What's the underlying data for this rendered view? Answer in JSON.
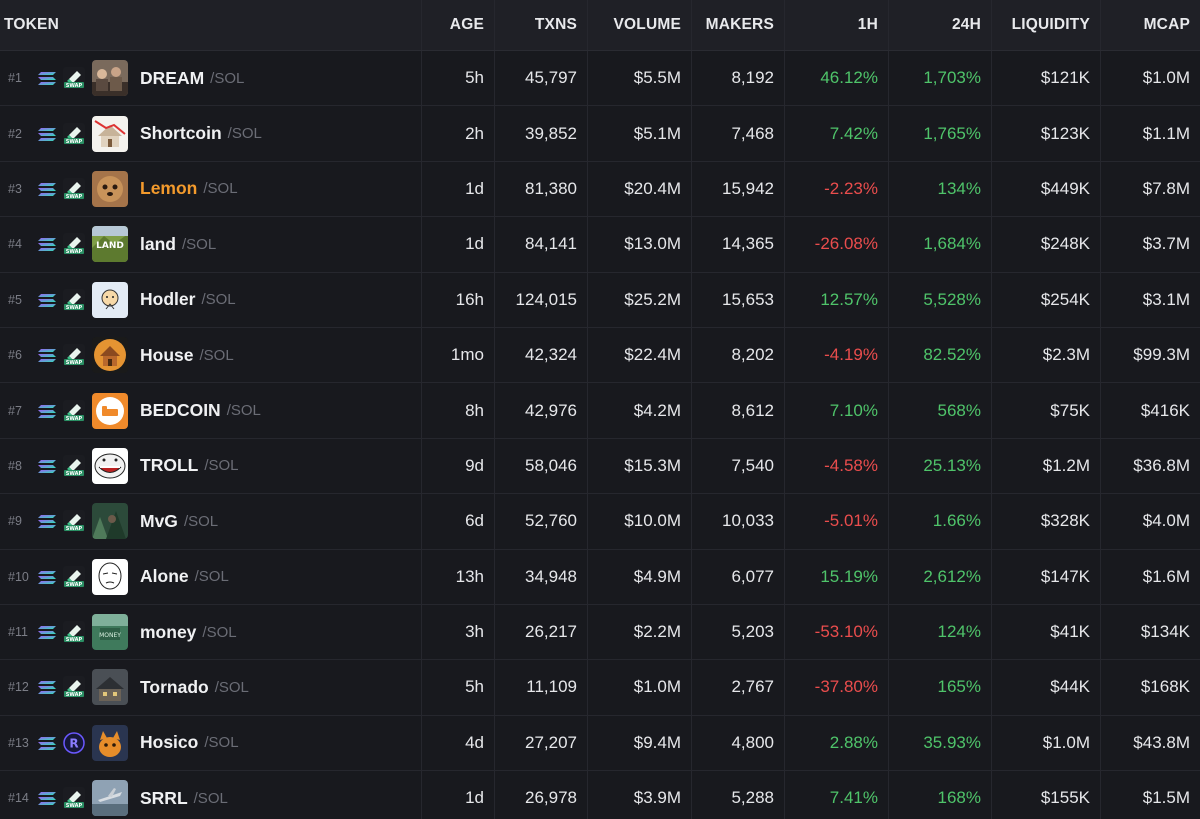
{
  "header": {
    "token": "TOKEN",
    "age": "AGE",
    "txns": "TXNS",
    "volume": "VOLUME",
    "makers": "MAKERS",
    "h1": "1H",
    "h24": "24H",
    "liquidity": "LIQUIDITY",
    "mcap": "MCAP"
  },
  "colors": {
    "positive": "#4fc46a",
    "negative": "#ea4d4d",
    "highlight": "#f39a2c"
  },
  "rows": [
    {
      "rank": "#1",
      "symbol": "DREAM",
      "quote": "/SOL",
      "dex": "swap-icon",
      "avatar": "dream-avatar",
      "age": "5h",
      "txns": "45,797",
      "volume": "$5.5M",
      "makers": "8,192",
      "h1": "46.12%",
      "h1_dir": "pos",
      "h24": "1,703%",
      "h24_dir": "pos",
      "liquidity": "$121K",
      "mcap": "$1.0M"
    },
    {
      "rank": "#2",
      "symbol": "Shortcoin",
      "quote": "/SOL",
      "dex": "swap-icon",
      "avatar": "shortcoin-avatar",
      "age": "2h",
      "txns": "39,852",
      "volume": "$5.1M",
      "makers": "7,468",
      "h1": "7.42%",
      "h1_dir": "pos",
      "h24": "1,765%",
      "h24_dir": "pos",
      "liquidity": "$123K",
      "mcap": "$1.1M"
    },
    {
      "rank": "#3",
      "symbol": "Lemon",
      "quote": "/SOL",
      "dex": "swap-icon",
      "avatar": "lemon-avatar",
      "age": "1d",
      "txns": "81,380",
      "volume": "$20.4M",
      "makers": "15,942",
      "h1": "-2.23%",
      "h1_dir": "neg",
      "h24": "134%",
      "h24_dir": "pos",
      "liquidity": "$449K",
      "mcap": "$7.8M",
      "highlight": true
    },
    {
      "rank": "#4",
      "symbol": "land",
      "quote": "/SOL",
      "dex": "swap-icon",
      "avatar": "land-avatar",
      "age": "1d",
      "txns": "84,141",
      "volume": "$13.0M",
      "makers": "14,365",
      "h1": "-26.08%",
      "h1_dir": "neg",
      "h24": "1,684%",
      "h24_dir": "pos",
      "liquidity": "$248K",
      "mcap": "$3.7M"
    },
    {
      "rank": "#5",
      "symbol": "Hodler",
      "quote": "/SOL",
      "dex": "swap-icon",
      "avatar": "hodler-avatar",
      "age": "16h",
      "txns": "124,015",
      "volume": "$25.2M",
      "makers": "15,653",
      "h1": "12.57%",
      "h1_dir": "pos",
      "h24": "5,528%",
      "h24_dir": "pos",
      "liquidity": "$254K",
      "mcap": "$3.1M"
    },
    {
      "rank": "#6",
      "symbol": "House",
      "quote": "/SOL",
      "dex": "swap-icon",
      "avatar": "house-avatar",
      "age": "1mo",
      "txns": "42,324",
      "volume": "$22.4M",
      "makers": "8,202",
      "h1": "-4.19%",
      "h1_dir": "neg",
      "h24": "82.52%",
      "h24_dir": "pos",
      "liquidity": "$2.3M",
      "mcap": "$99.3M"
    },
    {
      "rank": "#7",
      "symbol": "BEDCOIN",
      "quote": "/SOL",
      "dex": "swap-icon",
      "avatar": "bedcoin-avatar",
      "age": "8h",
      "txns": "42,976",
      "volume": "$4.2M",
      "makers": "8,612",
      "h1": "7.10%",
      "h1_dir": "pos",
      "h24": "568%",
      "h24_dir": "pos",
      "liquidity": "$75K",
      "mcap": "$416K"
    },
    {
      "rank": "#8",
      "symbol": "TROLL",
      "quote": "/SOL",
      "dex": "swap-icon",
      "avatar": "troll-avatar",
      "age": "9d",
      "txns": "58,046",
      "volume": "$15.3M",
      "makers": "7,540",
      "h1": "-4.58%",
      "h1_dir": "neg",
      "h24": "25.13%",
      "h24_dir": "pos",
      "liquidity": "$1.2M",
      "mcap": "$36.8M"
    },
    {
      "rank": "#9",
      "symbol": "MvG",
      "quote": "/SOL",
      "dex": "swap-icon",
      "avatar": "mvg-avatar",
      "age": "6d",
      "txns": "52,760",
      "volume": "$10.0M",
      "makers": "10,033",
      "h1": "-5.01%",
      "h1_dir": "neg",
      "h24": "1.66%",
      "h24_dir": "pos",
      "liquidity": "$328K",
      "mcap": "$4.0M"
    },
    {
      "rank": "#10",
      "symbol": "Alone",
      "quote": "/SOL",
      "dex": "swap-icon",
      "avatar": "alone-avatar",
      "age": "13h",
      "txns": "34,948",
      "volume": "$4.9M",
      "makers": "6,077",
      "h1": "15.19%",
      "h1_dir": "pos",
      "h24": "2,612%",
      "h24_dir": "pos",
      "liquidity": "$147K",
      "mcap": "$1.6M"
    },
    {
      "rank": "#11",
      "symbol": "money",
      "quote": "/SOL",
      "dex": "swap-icon",
      "avatar": "money-avatar",
      "age": "3h",
      "txns": "26,217",
      "volume": "$2.2M",
      "makers": "5,203",
      "h1": "-53.10%",
      "h1_dir": "neg",
      "h24": "124%",
      "h24_dir": "pos",
      "liquidity": "$41K",
      "mcap": "$134K"
    },
    {
      "rank": "#12",
      "symbol": "Tornado",
      "quote": "/SOL",
      "dex": "swap-icon",
      "avatar": "tornado-avatar",
      "age": "5h",
      "txns": "11,109",
      "volume": "$1.0M",
      "makers": "2,767",
      "h1": "-37.80%",
      "h1_dir": "neg",
      "h24": "165%",
      "h24_dir": "pos",
      "liquidity": "$44K",
      "mcap": "$168K"
    },
    {
      "rank": "#13",
      "symbol": "Hosico",
      "quote": "/SOL",
      "dex": "raydium-icon",
      "avatar": "hosico-avatar",
      "age": "4d",
      "txns": "27,207",
      "volume": "$9.4M",
      "makers": "4,800",
      "h1": "2.88%",
      "h1_dir": "pos",
      "h24": "35.93%",
      "h24_dir": "pos",
      "liquidity": "$1.0M",
      "mcap": "$43.8M"
    },
    {
      "rank": "#14",
      "symbol": "SRRL",
      "quote": "/SOL",
      "dex": "swap-icon",
      "avatar": "srrl-avatar",
      "age": "1d",
      "txns": "26,978",
      "volume": "$3.9M",
      "makers": "5,288",
      "h1": "7.41%",
      "h1_dir": "pos",
      "h24": "168%",
      "h24_dir": "pos",
      "liquidity": "$155K",
      "mcap": "$1.5M"
    }
  ]
}
